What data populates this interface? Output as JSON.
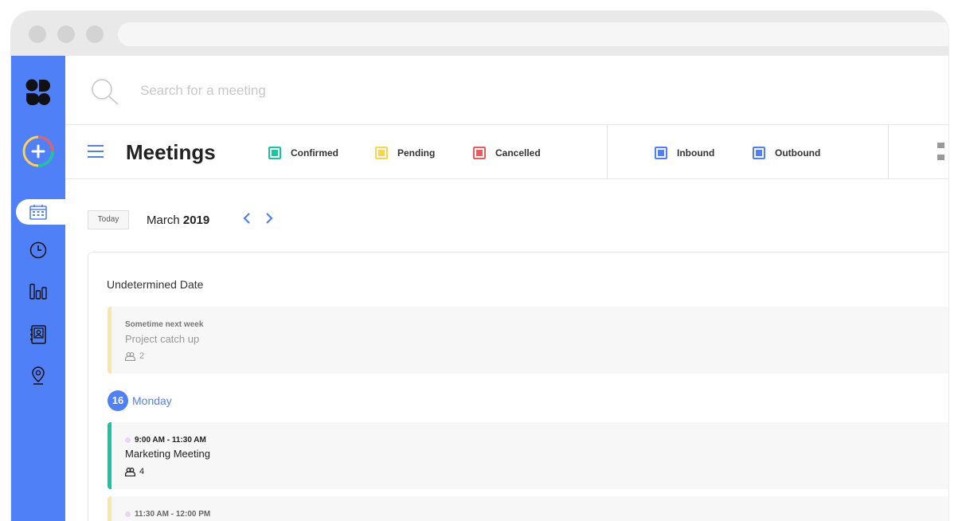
{
  "search": {
    "placeholder": "Search for a meeting"
  },
  "header": {
    "title": "Meetings",
    "status_legend": [
      {
        "label": "Confirmed",
        "color": "#14c7a0"
      },
      {
        "label": "Pending",
        "color": "#ffd24d"
      },
      {
        "label": "Cancelled",
        "color": "#e85e5e"
      }
    ],
    "direction_legend": [
      {
        "label": "Inbound",
        "color": "#4f80f7"
      },
      {
        "label": "Outbound",
        "color": "#4f80f7"
      }
    ]
  },
  "calendar": {
    "today_label": "Today",
    "month": "March",
    "year": "2019"
  },
  "sections": {
    "undetermined": {
      "title": "Undetermined Date",
      "event": {
        "time": "Sometime next week",
        "title": "Project catch up",
        "people": "2",
        "accent": "#f7e7a6"
      }
    },
    "day": {
      "number": "16",
      "name": "Monday",
      "events": [
        {
          "time": "9:00 AM - 11:30 AM",
          "title": "Marketing Meeting",
          "people": "4",
          "accent": "#14c7a0"
        },
        {
          "time": "11:30 AM - 12:00 PM",
          "title": "",
          "people": "",
          "accent": "#f7e7a6"
        }
      ]
    }
  },
  "sidebar": {
    "items": [
      {
        "icon": "calendar-icon"
      },
      {
        "icon": "clock-icon"
      },
      {
        "icon": "bar-chart-icon"
      },
      {
        "icon": "contacts-icon"
      },
      {
        "icon": "location-pin-icon"
      }
    ]
  }
}
